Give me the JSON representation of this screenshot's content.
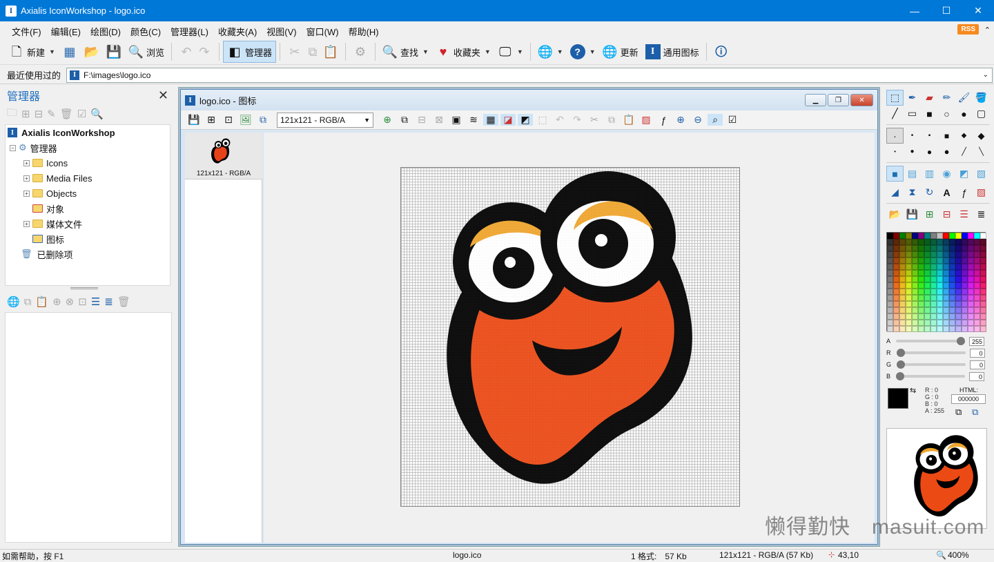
{
  "window": {
    "title": "Axialis IconWorkshop - logo.ico",
    "minimize": "—",
    "maximize": "☐",
    "close": "✕"
  },
  "menu": [
    "文件(F)",
    "编辑(E)",
    "绘图(D)",
    "颜色(C)",
    "管理器(L)",
    "收藏夹(A)",
    "视图(V)",
    "窗口(W)",
    "帮助(H)"
  ],
  "rss": "RSS",
  "toolbar": {
    "new": "新建",
    "browse": "浏览",
    "manager": "管理器",
    "find": "查找",
    "favorites": "收藏夹",
    "update": "更新",
    "universal_icon": "通用图标"
  },
  "address": {
    "label": "最近使用过的",
    "value": "F:\\images\\logo.ico"
  },
  "manager": {
    "title": "管理器",
    "tree": {
      "root": "Axialis IconWorkshop",
      "manager": "管理器",
      "items": [
        "Icons",
        "Media Files",
        "Objects",
        "对象",
        "媒体文件",
        "图标"
      ],
      "deleted": "已删除项"
    }
  },
  "doc": {
    "title": "logo.ico - 图标",
    "format_select": "121x121 - RGB/A",
    "thumb_caption": "121x121 - RGB/A"
  },
  "color": {
    "sliders": [
      {
        "label": "A",
        "value": "255",
        "level": 1.0
      },
      {
        "label": "R",
        "value": "0",
        "level": 0
      },
      {
        "label": "G",
        "value": "0",
        "level": 0
      },
      {
        "label": "B",
        "value": "0",
        "level": 0
      }
    ],
    "rgba_text": [
      "R : 0",
      "G : 0",
      "B : 0",
      "A : 255"
    ],
    "html_label": "HTML:",
    "html_value": "000000",
    "accent": "#0078d7"
  },
  "status": {
    "help": "如需帮助，按 F1",
    "file": "logo.ico",
    "formats": "1 格式:　57 Kb",
    "format_info": "121x121 - RGB/A (57 Kb)",
    "coords": "43,10",
    "zoom": "400%"
  },
  "watermark": "懒得勤快　masuit.com"
}
